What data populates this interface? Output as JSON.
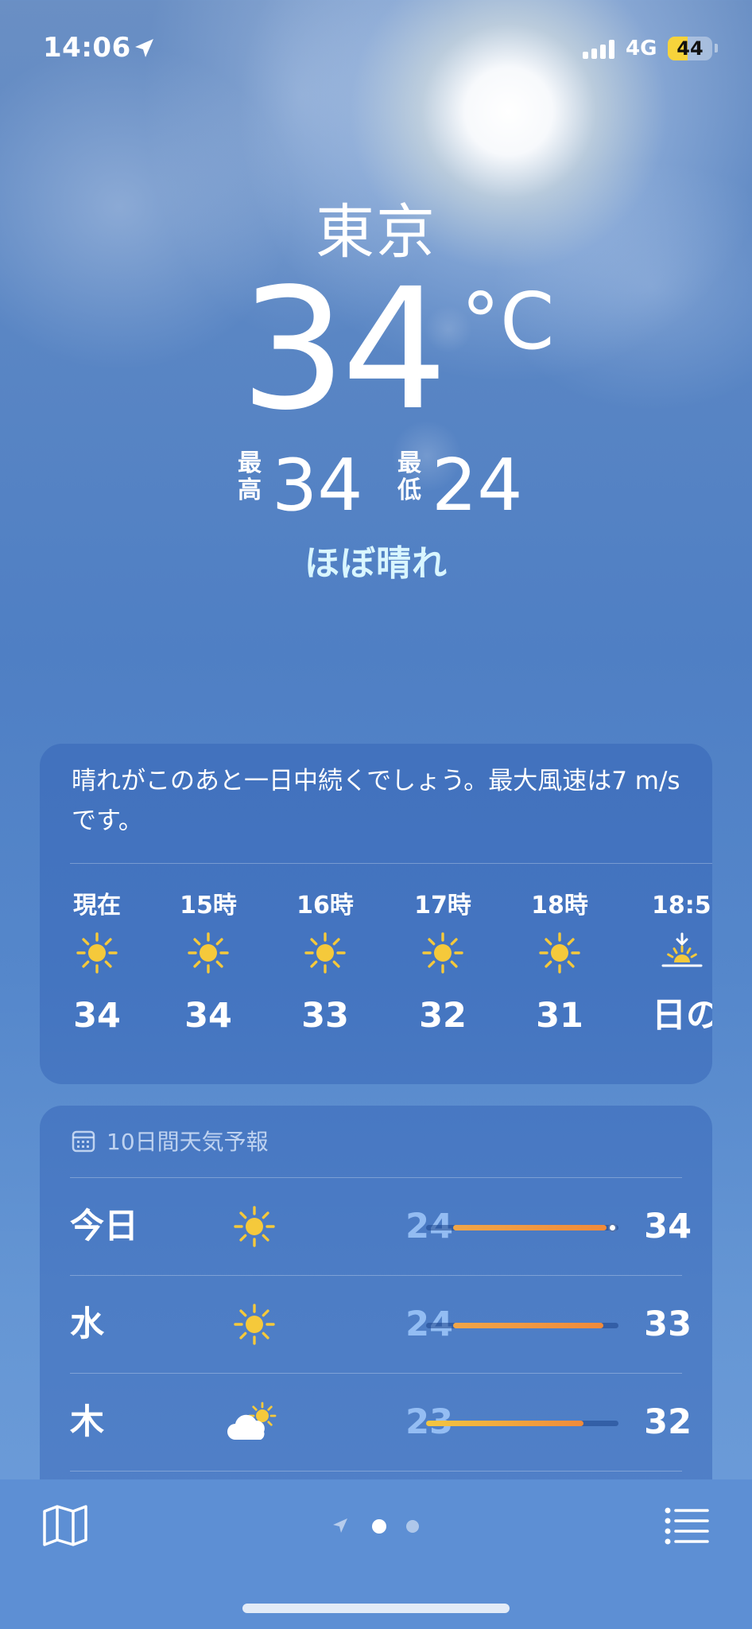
{
  "status_bar": {
    "time": "14:06",
    "network": "4G",
    "battery": "44",
    "battery_level_percent": 44,
    "icons": [
      "location-arrow-icon",
      "signal-icon",
      "battery-icon"
    ]
  },
  "header": {
    "city": "東京",
    "temperature": "34",
    "unit": "°C",
    "high_label": "最高",
    "high": "34",
    "low_label": "最低",
    "low": "24",
    "condition": "ほぼ晴れ"
  },
  "hourly_card": {
    "summary": "晴れがこのあと一日中続くでしょう。最大風速は7 m/s です。",
    "hours": [
      {
        "label": "現在",
        "icon": "sun-icon",
        "temp": "34"
      },
      {
        "label": "15時",
        "icon": "sun-icon",
        "temp": "34"
      },
      {
        "label": "16時",
        "icon": "sun-icon",
        "temp": "33"
      },
      {
        "label": "17時",
        "icon": "sun-icon",
        "temp": "32"
      },
      {
        "label": "18時",
        "icon": "sun-icon",
        "temp": "31"
      },
      {
        "label": "18:5",
        "icon": "sunset-icon",
        "temp": "日の"
      }
    ]
  },
  "daily_card": {
    "title": "10日間天気予報",
    "title_icon": "calendar-icon",
    "days": [
      {
        "day": "今日",
        "icon": "sun-icon",
        "low": "24",
        "high": "34",
        "range_start": 0.14,
        "range_end": 0.94,
        "current": 0.97
      },
      {
        "day": "水",
        "icon": "sun-icon",
        "low": "24",
        "high": "33",
        "range_start": 0.14,
        "range_end": 0.92
      },
      {
        "day": "木",
        "icon": "partly-cloudy-icon",
        "low": "23",
        "high": "32",
        "range_start": 0.0,
        "range_end": 0.82
      }
    ]
  },
  "bottom_bar": {
    "left_button": "map-icon",
    "right_button": "list-icon",
    "pager": [
      "location-arrow-icon",
      "page-dot-active",
      "page-dot"
    ]
  },
  "colors": {
    "sun": "#f5c93b",
    "bar_orange": "#f08a3a",
    "bar_yellow": "#f3c640",
    "condition_text": "#d9f6ff",
    "battery": "#f7d33b"
  }
}
